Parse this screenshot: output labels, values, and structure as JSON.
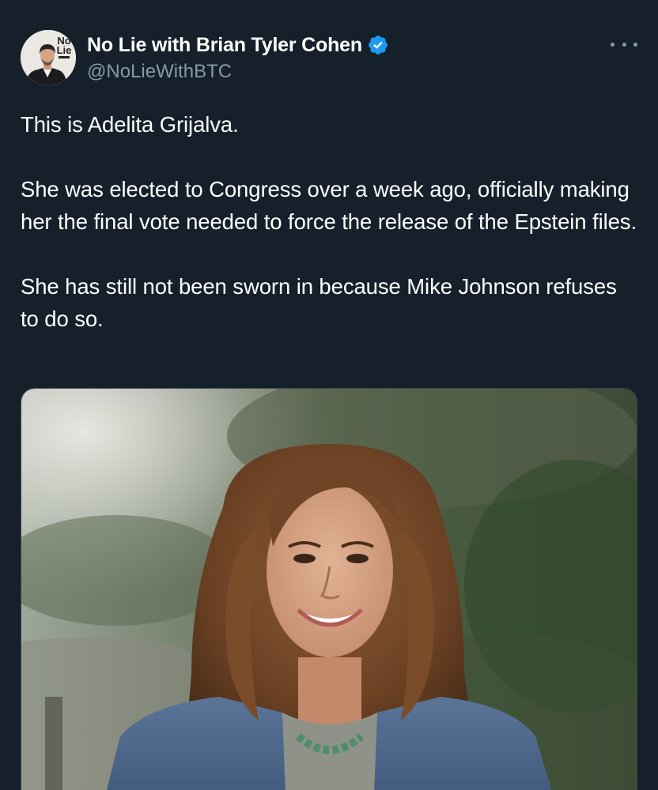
{
  "tweet": {
    "author": {
      "display_name": "No Lie with Brian Tyler Cohen",
      "handle": "@NoLieWithBTC",
      "verified": true,
      "avatar_text_top": "No",
      "avatar_text_bottom": "Lie"
    },
    "more_icon": "more-horizontal-icon",
    "text_paragraphs": [
      "This is Adelita Grijalva.",
      "She was elected to Congress over a week ago, officially making her the final vote needed to force the release of the Epstein files.",
      "She has still not been sworn in because Mike Johnson refuses to do so."
    ],
    "media": {
      "type": "photo",
      "subject": "portrait photo"
    }
  },
  "colors": {
    "background": "#15202b",
    "text_primary": "#ffffff",
    "text_secondary": "#8899a6",
    "verified_blue": "#1d9bf0",
    "media_border": "#38444d"
  }
}
